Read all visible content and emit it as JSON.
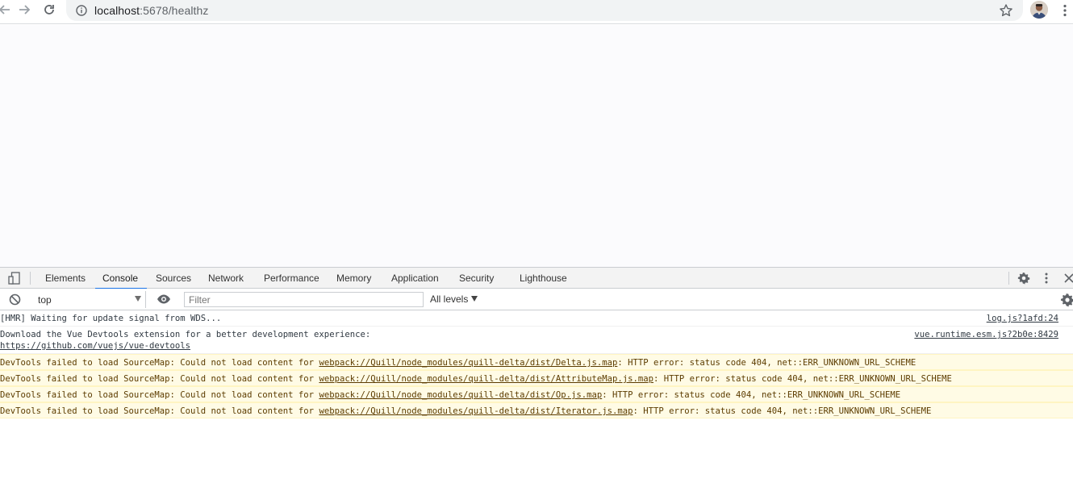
{
  "browser": {
    "url_host": "localhost",
    "url_path": ":5678/healthz",
    "icons": {
      "back": "arrow-left-icon",
      "forward": "arrow-right-icon",
      "reload": "reload-icon",
      "info": "info-icon",
      "bookmark": "star-icon",
      "profile": "avatar",
      "menu": "kebab-icon"
    }
  },
  "devtools": {
    "tabs": [
      {
        "label": "Elements"
      },
      {
        "label": "Console"
      },
      {
        "label": "Sources"
      },
      {
        "label": "Network"
      },
      {
        "label": "Performance"
      },
      {
        "label": "Memory"
      },
      {
        "label": "Application"
      },
      {
        "label": "Security"
      },
      {
        "label": "Lighthouse"
      }
    ],
    "active_tab": "Console",
    "accent_color": "#1a73e8",
    "console_toolbar": {
      "context": "top",
      "filter_placeholder": "Filter",
      "levels": "All levels"
    },
    "messages": [
      {
        "text": "[HMR] Waiting for update signal from WDS...",
        "source": "log.js?1afd:24"
      },
      {
        "text": "Download the Vue Devtools extension for a better development experience:",
        "link": "https://github.com/vuejs/vue-devtools",
        "source": "vue.runtime.esm.js?2b0e:8429"
      }
    ],
    "warnings": [
      {
        "prefix": "DevTools failed to load SourceMap: Could not load content for ",
        "link": "webpack://Quill/node_modules/quill-delta/dist/Delta.js.map",
        "suffix": ": HTTP error: status code 404, net::ERR_UNKNOWN_URL_SCHEME"
      },
      {
        "prefix": "DevTools failed to load SourceMap: Could not load content for ",
        "link": "webpack://Quill/node_modules/quill-delta/dist/AttributeMap.js.map",
        "suffix": ": HTTP error: status code 404, net::ERR_UNKNOWN_URL_SCHEME"
      },
      {
        "prefix": "DevTools failed to load SourceMap: Could not load content for ",
        "link": "webpack://Quill/node_modules/quill-delta/dist/Op.js.map",
        "suffix": ": HTTP error: status code 404, net::ERR_UNKNOWN_URL_SCHEME"
      },
      {
        "prefix": "DevTools failed to load SourceMap: Could not load content for ",
        "link": "webpack://Quill/node_modules/quill-delta/dist/Iterator.js.map",
        "suffix": ": HTTP error: status code 404, net::ERR_UNKNOWN_URL_SCHEME"
      }
    ],
    "warning_bg": "#fffbe5"
  }
}
